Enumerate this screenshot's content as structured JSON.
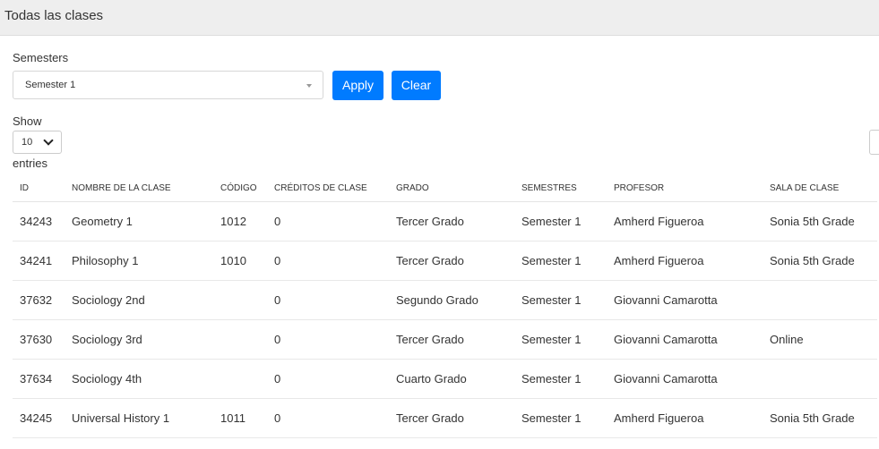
{
  "header": {
    "title": "Todas las clases"
  },
  "filter": {
    "label": "Semesters",
    "selected": "Semester 1",
    "apply_label": "Apply",
    "clear_label": "Clear"
  },
  "length_menu": {
    "show_label": "Show",
    "selected": "10",
    "entries_label": "entries"
  },
  "table": {
    "headers": {
      "id": "ID",
      "name": "NOMBRE DE LA CLASE",
      "code": "CÓDIGO",
      "credits": "CRÉDITOS DE CLASE",
      "grade": "GRADO",
      "semester": "SEMESTRES",
      "teacher": "PROFESOR",
      "room": "SALA DE CLASE"
    },
    "rows": [
      {
        "id": "34243",
        "name": "Geometry 1",
        "code": "1012",
        "credits": "0",
        "grade": "Tercer Grado",
        "semester": "Semester 1",
        "teacher": "Amherd Figueroa",
        "room": "Sonia 5th Grade"
      },
      {
        "id": "34241",
        "name": "Philosophy 1",
        "code": "1010",
        "credits": "0",
        "grade": "Tercer Grado",
        "semester": "Semester 1",
        "teacher": "Amherd Figueroa",
        "room": "Sonia 5th Grade"
      },
      {
        "id": "37632",
        "name": "Sociology 2nd",
        "code": "",
        "credits": "0",
        "grade": "Segundo Grado",
        "semester": "Semester 1",
        "teacher": "Giovanni Camarotta",
        "room": ""
      },
      {
        "id": "37630",
        "name": "Sociology 3rd",
        "code": "",
        "credits": "0",
        "grade": "Tercer Grado",
        "semester": "Semester 1",
        "teacher": "Giovanni Camarotta",
        "room": "Online"
      },
      {
        "id": "37634",
        "name": "Sociology 4th",
        "code": "",
        "credits": "0",
        "grade": "Cuarto Grado",
        "semester": "Semester 1",
        "teacher": "Giovanni Camarotta",
        "room": ""
      },
      {
        "id": "34245",
        "name": "Universal History 1",
        "code": "1011",
        "credits": "0",
        "grade": "Tercer Grado",
        "semester": "Semester 1",
        "teacher": "Amherd Figueroa",
        "room": "Sonia 5th Grade"
      }
    ]
  },
  "colors": {
    "primary_button": "#007bff",
    "header_bg": "#eeeeee",
    "row_border": "#e8e8e8"
  }
}
